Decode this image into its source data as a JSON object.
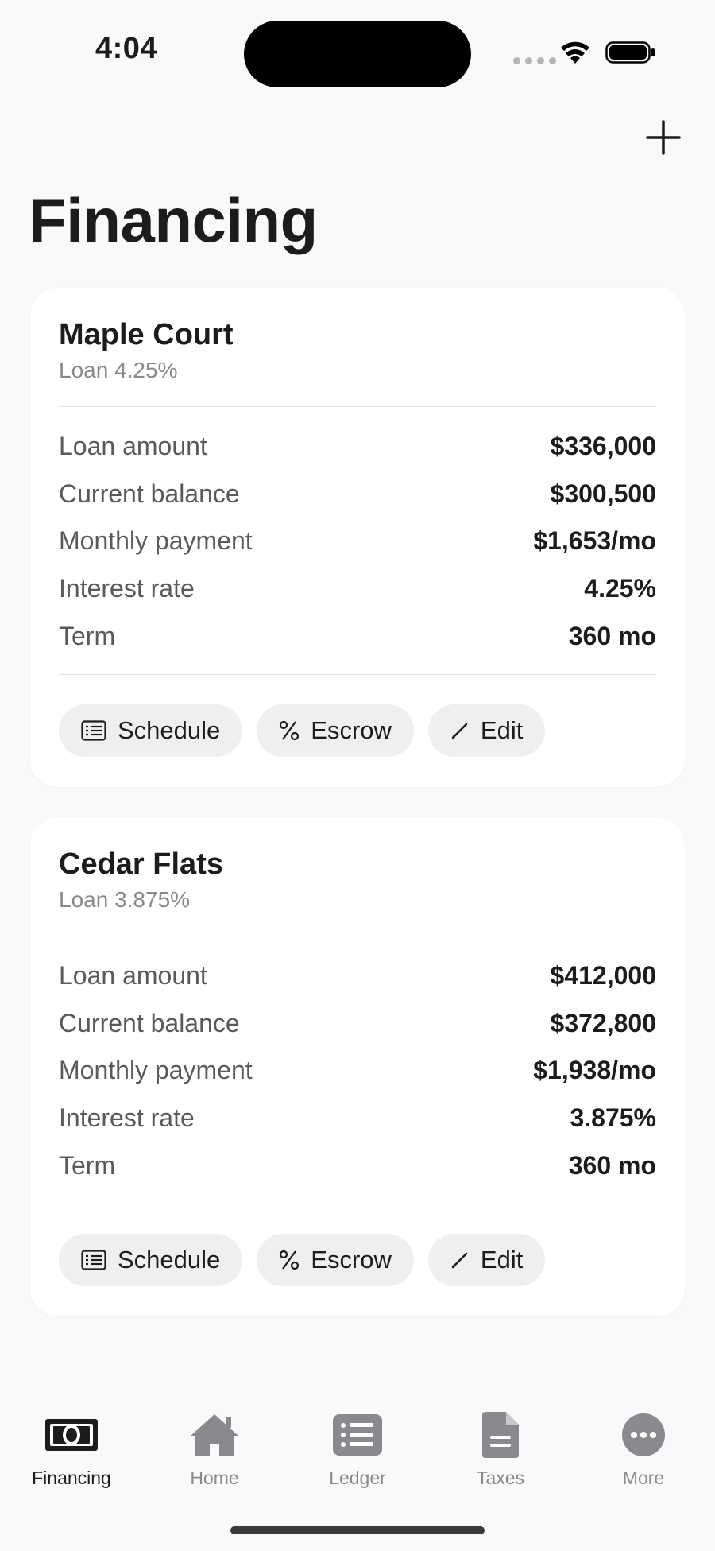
{
  "status_bar": {
    "time": "4:04"
  },
  "header": {
    "title": "Financing",
    "add_icon": "plus-icon"
  },
  "loans": [
    {
      "name": "Maple Court",
      "subtitle": "Loan 4.25%",
      "rows": [
        {
          "label": "Loan amount",
          "value": "$336,000"
        },
        {
          "label": "Current balance",
          "value": "$300,500"
        },
        {
          "label": "Monthly payment",
          "value": "$1,653/mo"
        },
        {
          "label": "Interest rate",
          "value": "4.25%"
        },
        {
          "label": "Term",
          "value": "360 mo"
        }
      ],
      "actions": {
        "schedule": "Schedule",
        "escrow": "Escrow",
        "edit": "Edit"
      }
    },
    {
      "name": "Cedar Flats",
      "subtitle": "Loan 3.875%",
      "rows": [
        {
          "label": "Loan amount",
          "value": "$412,000"
        },
        {
          "label": "Current balance",
          "value": "$372,800"
        },
        {
          "label": "Monthly payment",
          "value": "$1,938/mo"
        },
        {
          "label": "Interest rate",
          "value": "3.875%"
        },
        {
          "label": "Term",
          "value": "360 mo"
        }
      ],
      "actions": {
        "schedule": "Schedule",
        "escrow": "Escrow",
        "edit": "Edit"
      }
    }
  ],
  "tabbar": {
    "items": [
      {
        "label": "Financing",
        "icon": "banknote-icon",
        "active": true
      },
      {
        "label": "Home",
        "icon": "house-icon",
        "active": false
      },
      {
        "label": "Ledger",
        "icon": "list-icon",
        "active": false
      },
      {
        "label": "Taxes",
        "icon": "document-icon",
        "active": false
      },
      {
        "label": "More",
        "icon": "ellipsis-icon",
        "active": false
      }
    ]
  },
  "colors": {
    "accent": "#1c1c1e",
    "inactive": "#8a8a8e",
    "background": "#f9f9f9",
    "card": "#ffffff"
  }
}
